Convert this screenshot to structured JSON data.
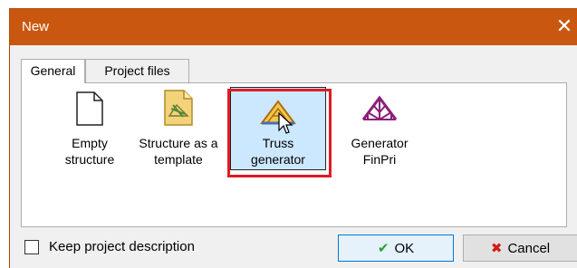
{
  "window": {
    "title": "New"
  },
  "tabs": [
    {
      "label": "General",
      "active": true
    },
    {
      "label": "Project files",
      "active": false
    }
  ],
  "items": [
    {
      "line1": "Empty",
      "line2": "structure",
      "icon": "blank-document-icon"
    },
    {
      "line1": "Structure as a",
      "line2": "template",
      "icon": "template-document-icon"
    },
    {
      "line1": "Truss",
      "line2": "generator",
      "icon": "truss-generator-icon",
      "selected": true
    },
    {
      "line1": "Generator",
      "line2": "FinPri",
      "icon": "finpri-generator-icon"
    }
  ],
  "footer": {
    "checkbox_label": "Keep project description",
    "ok_label": "OK",
    "cancel_label": "Cancel"
  },
  "colors": {
    "titlebar": "#c9570f",
    "selection": "#cce8ff",
    "highlight": "#e01b24",
    "ok_check": "#2e9e2e",
    "cancel_x": "#d11a1a",
    "finpri": "#8a1f7a"
  }
}
